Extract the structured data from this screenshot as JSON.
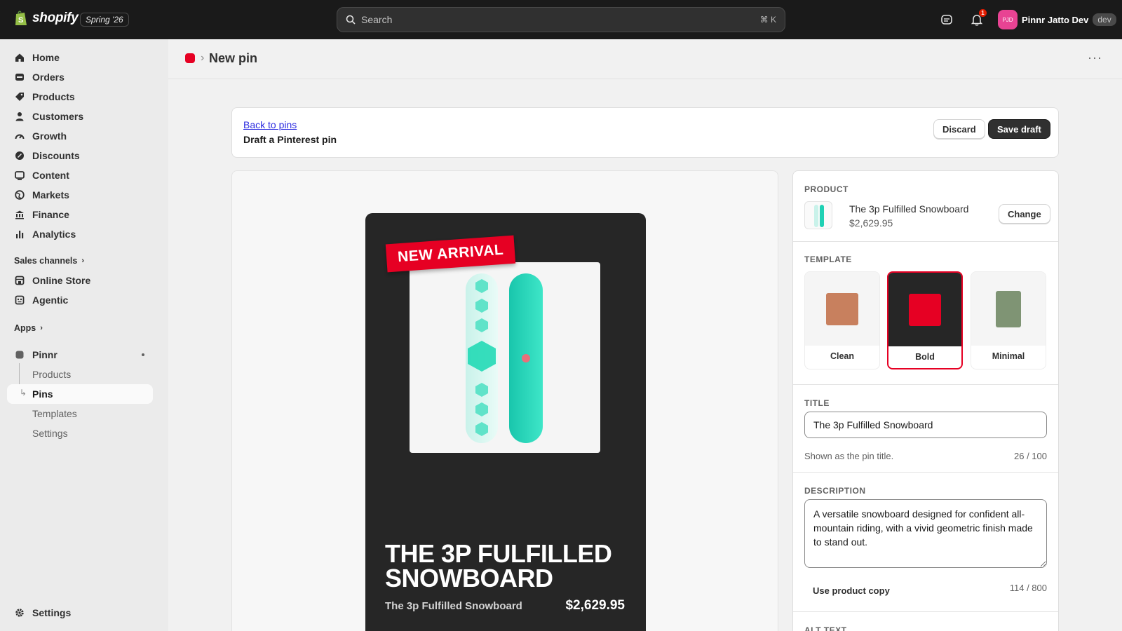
{
  "topbar": {
    "brand": "shopify",
    "edition": "Spring '26",
    "search_placeholder": "Search",
    "search_shortcut": "⌘ K",
    "notification_count": "1",
    "store_initials": "PJD",
    "store_name": "Pinnr Jatto Dev",
    "store_env": "dev"
  },
  "sidebar": {
    "items": [
      {
        "label": "Home",
        "icon": "home-icon"
      },
      {
        "label": "Orders",
        "icon": "orders-icon"
      },
      {
        "label": "Products",
        "icon": "tag-icon"
      },
      {
        "label": "Customers",
        "icon": "person-icon"
      },
      {
        "label": "Growth",
        "icon": "gauge-icon"
      },
      {
        "label": "Discounts",
        "icon": "discount-icon"
      },
      {
        "label": "Content",
        "icon": "content-icon"
      },
      {
        "label": "Markets",
        "icon": "globe-icon"
      },
      {
        "label": "Finance",
        "icon": "bank-icon"
      },
      {
        "label": "Analytics",
        "icon": "bar-chart-icon"
      }
    ],
    "sales_channels_label": "Sales channels",
    "channels": [
      {
        "label": "Online Store",
        "icon": "store-icon"
      },
      {
        "label": "Agentic",
        "icon": "robot-icon"
      }
    ],
    "apps_label": "Apps",
    "app": {
      "label": "Pinnr",
      "icon": "pinnr-app-icon"
    },
    "app_subitems": [
      "Products",
      "Pins",
      "Templates",
      "Settings"
    ],
    "active_subitem": "Pins",
    "settings_label": "Settings"
  },
  "header": {
    "title": "New pin"
  },
  "toolbar": {
    "back_link": "Back to pins",
    "subtitle": "Draft a Pinterest pin",
    "discard_label": "Discard",
    "save_label": "Save draft"
  },
  "preview": {
    "ribbon": "NEW ARRIVAL",
    "headline": "THE 3P FULFILLED SNOWBOARD",
    "product_name": "The 3p Fulfilled Snowboard",
    "price": "$2,629.95",
    "colors": {
      "background": "#262626",
      "accent": "#e60023",
      "board": "#1fd1b4"
    }
  },
  "panel": {
    "product_label": "PRODUCT",
    "product_name": "The 3p Fulfilled Snowboard",
    "product_price": "$2,629.95",
    "change_label": "Change",
    "template_label": "TEMPLATE",
    "templates": [
      {
        "name": "Clean",
        "bg": "#f5f5f5",
        "swatch": "#c8805e"
      },
      {
        "name": "Bold",
        "bg": "#262626",
        "swatch": "#e60023"
      },
      {
        "name": "Minimal",
        "bg": "#f5f5f5",
        "swatch": "#7f9474"
      }
    ],
    "selected_template": "Bold",
    "title_label": "TITLE",
    "title_value": "The 3p Fulfilled Snowboard",
    "title_help": "Shown as the pin title.",
    "title_count": "26 / 100",
    "description_label": "DESCRIPTION",
    "description_value": "A versatile snowboard designed for confident all-mountain riding, with a vivid geometric finish made to stand out.",
    "use_copy_label": "Use product copy",
    "description_count": "114 / 800",
    "alt_label": "ALT TEXT"
  }
}
